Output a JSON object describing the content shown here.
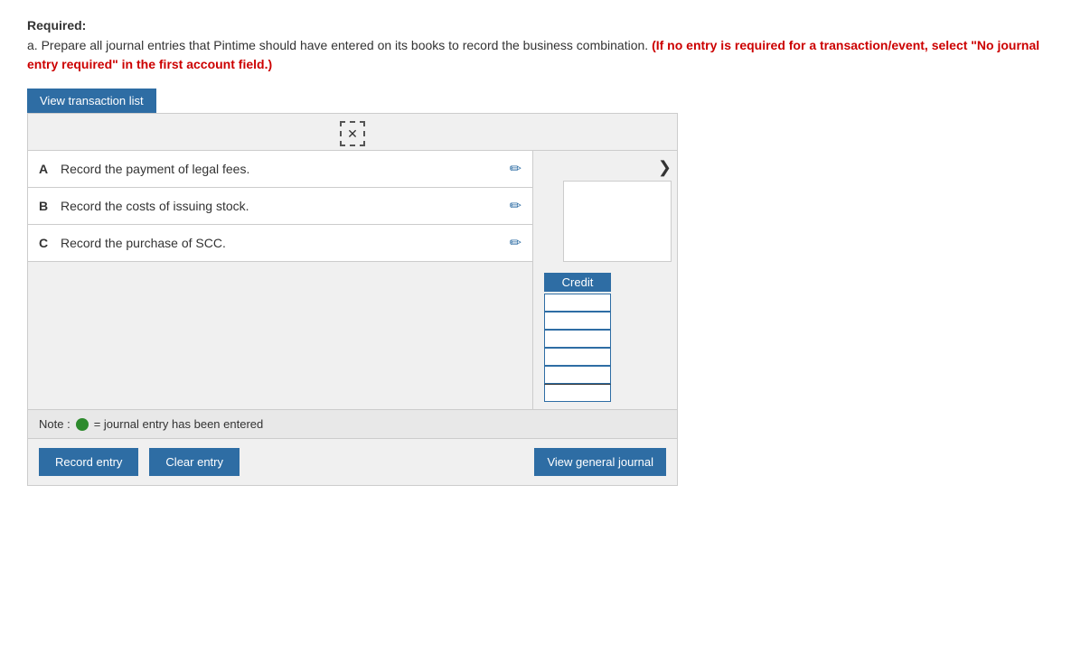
{
  "required_label": "Required:",
  "instruction_plain": "a. Prepare all journal entries that Pintime should have entered on its books to record the business combination.",
  "instruction_bold_red": "(If no entry is required for a transaction/event, select \"No journal entry required\" in the first account field.)",
  "view_transaction_btn": "View transaction list",
  "close_icon": "✕",
  "chevron_icon": "❯",
  "transactions": [
    {
      "letter": "A",
      "text": "Record the payment of legal fees."
    },
    {
      "letter": "B",
      "text": "Record the costs of issuing stock."
    },
    {
      "letter": "C",
      "text": "Record the purchase of SCC."
    }
  ],
  "credit_label": "Credit",
  "credit_rows": [
    "",
    "",
    "",
    "",
    "",
    ""
  ],
  "note_prefix": "Note :",
  "note_suffix": "= journal entry has been entered",
  "record_entry_btn": "Record entry",
  "clear_entry_btn": "Clear entry",
  "view_general_journal_btn": "View general journal"
}
